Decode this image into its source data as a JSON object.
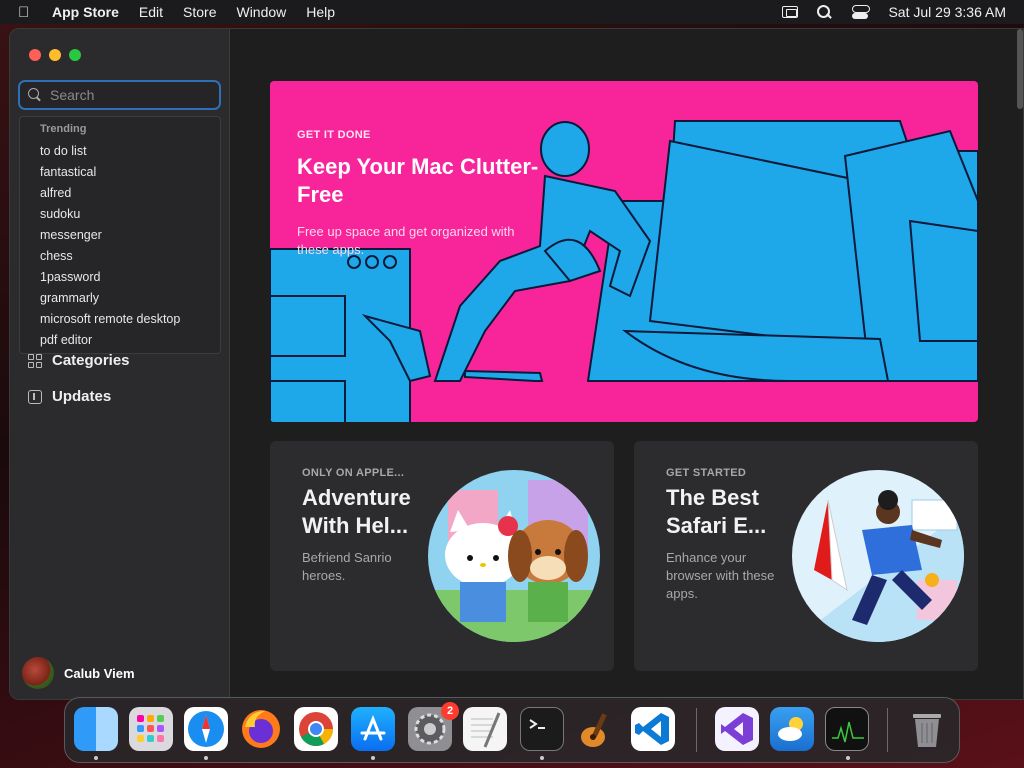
{
  "menubar": {
    "app_name": "App Store",
    "menus": [
      "Edit",
      "Store",
      "Window",
      "Help"
    ],
    "datetime": "Sat Jul 29  3:36 AM"
  },
  "sidebar": {
    "search_placeholder": "Search",
    "dropdown": {
      "header": "Trending",
      "items": [
        "to do list",
        "fantastical",
        "alfred",
        "sudoku",
        "messenger",
        "chess",
        "1password",
        "grammarly",
        "microsoft remote desktop",
        "pdf editor"
      ]
    },
    "nav": {
      "categories": "Categories",
      "updates": "Updates"
    },
    "user_name": "Calub Viem"
  },
  "hero": {
    "eyebrow": "GET IT DONE",
    "title": "Keep Your Mac Clutter-Free",
    "subtitle": "Free up space and get organized with these apps."
  },
  "cards": [
    {
      "eyebrow": "ONLY ON APPLE...",
      "title": "Adventure With Hel...",
      "subtitle": "Befriend Sanrio heroes."
    },
    {
      "eyebrow": "GET STARTED",
      "title": "The Best Safari E...",
      "subtitle": "Enhance your browser with these apps."
    }
  ],
  "dock": {
    "settings_badge": "2",
    "icons": [
      "finder-icon",
      "launchpad-icon",
      "safari-icon",
      "firefox-icon",
      "chrome-icon",
      "app-store-icon",
      "system-settings-icon",
      "textedit-icon",
      "terminal-icon",
      "garageband-icon",
      "vscode-icon",
      "visual-studio-icon",
      "weather-icon",
      "activity-monitor-icon",
      "trash-icon"
    ]
  }
}
